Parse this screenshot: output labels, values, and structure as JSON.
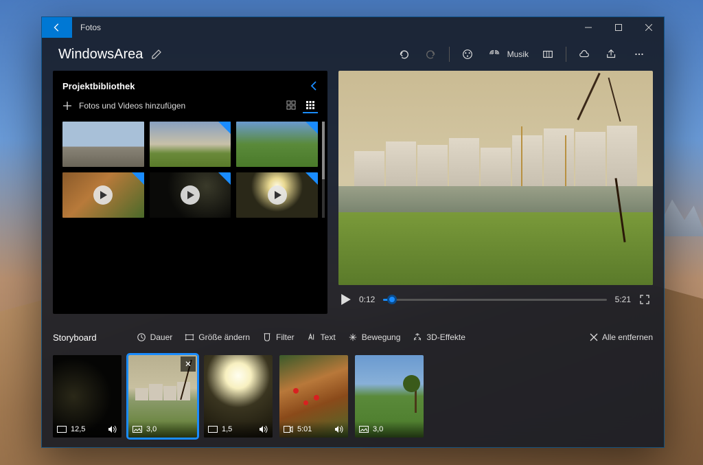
{
  "titlebar": {
    "app_name": "Fotos"
  },
  "header": {
    "project_title": "WindowsArea",
    "music_label": "Musik"
  },
  "library": {
    "title": "Projektbibliothek",
    "add_label": "Fotos und Videos hinzufügen"
  },
  "player": {
    "current_time": "0:12",
    "total_time": "5:21"
  },
  "storyboard": {
    "title": "Storyboard",
    "remove_all": "Alle entfernen",
    "tools": {
      "duration": "Dauer",
      "resize": "Größe ändern",
      "filter": "Filter",
      "text": "Text",
      "motion": "Bewegung",
      "effects3d": "3D-Effekte"
    },
    "clips": [
      {
        "duration": "12,5",
        "is_video": false,
        "has_audio": true
      },
      {
        "duration": "3,0",
        "is_video": false,
        "has_audio": false
      },
      {
        "duration": "1,5",
        "is_video": false,
        "has_audio": true
      },
      {
        "duration": "5:01",
        "is_video": true,
        "has_audio": true
      },
      {
        "duration": "3,0",
        "is_video": false,
        "has_audio": false
      }
    ]
  }
}
